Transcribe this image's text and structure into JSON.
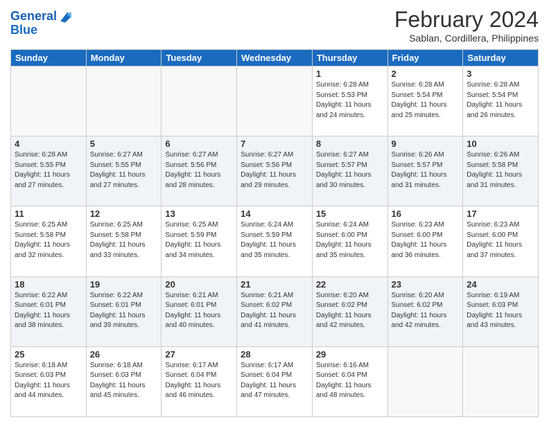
{
  "header": {
    "logo_line1": "General",
    "logo_line2": "Blue",
    "month_year": "February 2024",
    "location": "Sablan, Cordillera, Philippines"
  },
  "days_of_week": [
    "Sunday",
    "Monday",
    "Tuesday",
    "Wednesday",
    "Thursday",
    "Friday",
    "Saturday"
  ],
  "weeks": [
    [
      {
        "day": "",
        "info": ""
      },
      {
        "day": "",
        "info": ""
      },
      {
        "day": "",
        "info": ""
      },
      {
        "day": "",
        "info": ""
      },
      {
        "day": "1",
        "info": "Sunrise: 6:28 AM\nSunset: 5:53 PM\nDaylight: 11 hours and 24 minutes."
      },
      {
        "day": "2",
        "info": "Sunrise: 6:28 AM\nSunset: 5:54 PM\nDaylight: 11 hours and 25 minutes."
      },
      {
        "day": "3",
        "info": "Sunrise: 6:28 AM\nSunset: 5:54 PM\nDaylight: 11 hours and 26 minutes."
      }
    ],
    [
      {
        "day": "4",
        "info": "Sunrise: 6:28 AM\nSunset: 5:55 PM\nDaylight: 11 hours and 27 minutes."
      },
      {
        "day": "5",
        "info": "Sunrise: 6:27 AM\nSunset: 5:55 PM\nDaylight: 11 hours and 27 minutes."
      },
      {
        "day": "6",
        "info": "Sunrise: 6:27 AM\nSunset: 5:56 PM\nDaylight: 11 hours and 28 minutes."
      },
      {
        "day": "7",
        "info": "Sunrise: 6:27 AM\nSunset: 5:56 PM\nDaylight: 11 hours and 29 minutes."
      },
      {
        "day": "8",
        "info": "Sunrise: 6:27 AM\nSunset: 5:57 PM\nDaylight: 11 hours and 30 minutes."
      },
      {
        "day": "9",
        "info": "Sunrise: 6:26 AM\nSunset: 5:57 PM\nDaylight: 11 hours and 31 minutes."
      },
      {
        "day": "10",
        "info": "Sunrise: 6:26 AM\nSunset: 5:58 PM\nDaylight: 11 hours and 31 minutes."
      }
    ],
    [
      {
        "day": "11",
        "info": "Sunrise: 6:25 AM\nSunset: 5:58 PM\nDaylight: 11 hours and 32 minutes."
      },
      {
        "day": "12",
        "info": "Sunrise: 6:25 AM\nSunset: 5:58 PM\nDaylight: 11 hours and 33 minutes."
      },
      {
        "day": "13",
        "info": "Sunrise: 6:25 AM\nSunset: 5:59 PM\nDaylight: 11 hours and 34 minutes."
      },
      {
        "day": "14",
        "info": "Sunrise: 6:24 AM\nSunset: 5:59 PM\nDaylight: 11 hours and 35 minutes."
      },
      {
        "day": "15",
        "info": "Sunrise: 6:24 AM\nSunset: 6:00 PM\nDaylight: 11 hours and 35 minutes."
      },
      {
        "day": "16",
        "info": "Sunrise: 6:23 AM\nSunset: 6:00 PM\nDaylight: 11 hours and 36 minutes."
      },
      {
        "day": "17",
        "info": "Sunrise: 6:23 AM\nSunset: 6:00 PM\nDaylight: 11 hours and 37 minutes."
      }
    ],
    [
      {
        "day": "18",
        "info": "Sunrise: 6:22 AM\nSunset: 6:01 PM\nDaylight: 11 hours and 38 minutes."
      },
      {
        "day": "19",
        "info": "Sunrise: 6:22 AM\nSunset: 6:01 PM\nDaylight: 11 hours and 39 minutes."
      },
      {
        "day": "20",
        "info": "Sunrise: 6:21 AM\nSunset: 6:01 PM\nDaylight: 11 hours and 40 minutes."
      },
      {
        "day": "21",
        "info": "Sunrise: 6:21 AM\nSunset: 6:02 PM\nDaylight: 11 hours and 41 minutes."
      },
      {
        "day": "22",
        "info": "Sunrise: 6:20 AM\nSunset: 6:02 PM\nDaylight: 11 hours and 42 minutes."
      },
      {
        "day": "23",
        "info": "Sunrise: 6:20 AM\nSunset: 6:02 PM\nDaylight: 11 hours and 42 minutes."
      },
      {
        "day": "24",
        "info": "Sunrise: 6:19 AM\nSunset: 6:03 PM\nDaylight: 11 hours and 43 minutes."
      }
    ],
    [
      {
        "day": "25",
        "info": "Sunrise: 6:18 AM\nSunset: 6:03 PM\nDaylight: 11 hours and 44 minutes."
      },
      {
        "day": "26",
        "info": "Sunrise: 6:18 AM\nSunset: 6:03 PM\nDaylight: 11 hours and 45 minutes."
      },
      {
        "day": "27",
        "info": "Sunrise: 6:17 AM\nSunset: 6:04 PM\nDaylight: 11 hours and 46 minutes."
      },
      {
        "day": "28",
        "info": "Sunrise: 6:17 AM\nSunset: 6:04 PM\nDaylight: 11 hours and 47 minutes."
      },
      {
        "day": "29",
        "info": "Sunrise: 6:16 AM\nSunset: 6:04 PM\nDaylight: 11 hours and 48 minutes."
      },
      {
        "day": "",
        "info": ""
      },
      {
        "day": "",
        "info": ""
      }
    ]
  ]
}
